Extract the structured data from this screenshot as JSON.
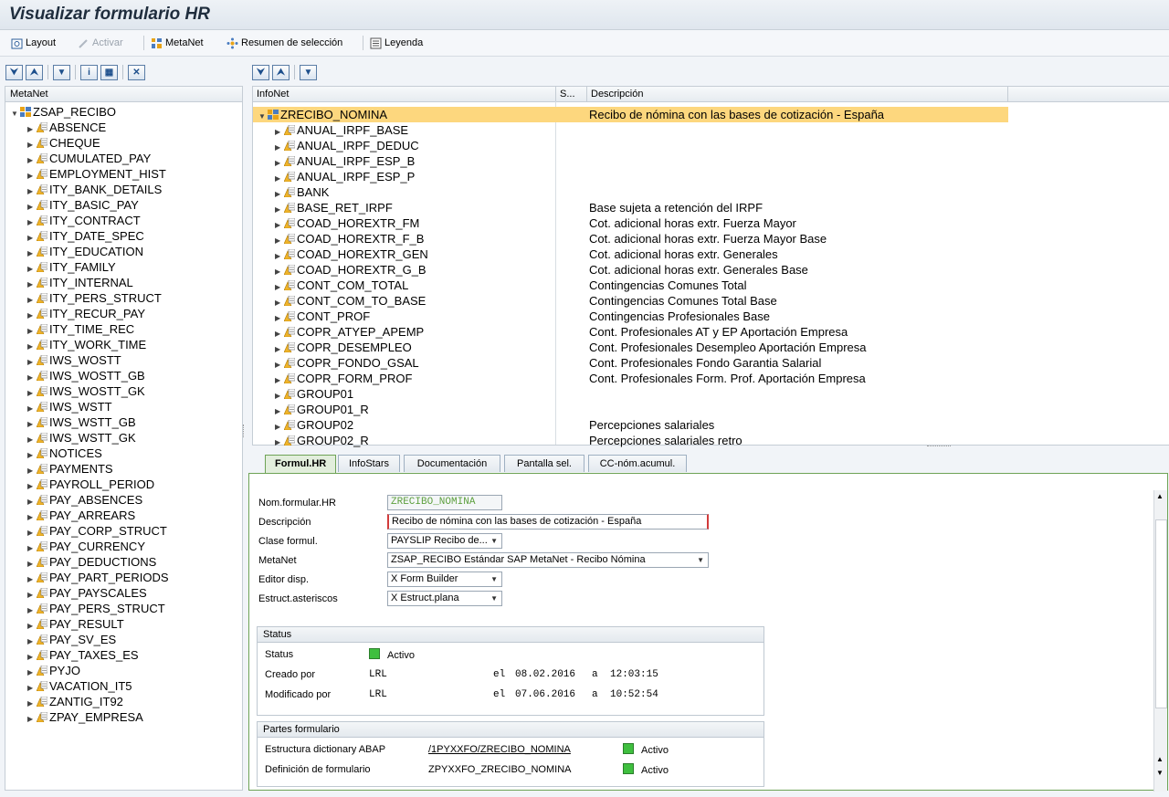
{
  "title": "Visualizar formulario HR",
  "toolbar": {
    "layout": "Layout",
    "activar": "Activar",
    "metanet": "MetaNet",
    "resumen": "Resumen de selección",
    "leyenda": "Leyenda"
  },
  "left": {
    "header": "MetaNet",
    "root": "ZSAP_RECIBO",
    "items": [
      "ABSENCE",
      "CHEQUE",
      "CUMULATED_PAY",
      "EMPLOYMENT_HIST",
      "ITY_BANK_DETAILS",
      "ITY_BASIC_PAY",
      "ITY_CONTRACT",
      "ITY_DATE_SPEC",
      "ITY_EDUCATION",
      "ITY_FAMILY",
      "ITY_INTERNAL",
      "ITY_PERS_STRUCT",
      "ITY_RECUR_PAY",
      "ITY_TIME_REC",
      "ITY_WORK_TIME",
      "IWS_WOSTT",
      "IWS_WOSTT_GB",
      "IWS_WOSTT_GK",
      "IWS_WSTT",
      "IWS_WSTT_GB",
      "IWS_WSTT_GK",
      "NOTICES",
      "PAYMENTS",
      "PAYROLL_PERIOD",
      "PAY_ABSENCES",
      "PAY_ARREARS",
      "PAY_CORP_STRUCT",
      "PAY_CURRENCY",
      "PAY_DEDUCTIONS",
      "PAY_PART_PERIODS",
      "PAY_PAYSCALES",
      "PAY_PERS_STRUCT",
      "PAY_RESULT",
      "PAY_SV_ES",
      "PAY_TAXES_ES",
      "PYJO",
      "VACATION_IT5",
      "ZANTIG_IT92",
      "ZPAY_EMPRESA"
    ]
  },
  "right": {
    "col_infonet": "InfoNet",
    "col_s": "S...",
    "col_desc": "Descripción",
    "root": {
      "name": "ZRECIBO_NOMINA",
      "desc": "Recibo de nómina con las bases de cotización - España"
    },
    "rows": [
      {
        "name": "ANUAL_IRPF_BASE",
        "desc": ""
      },
      {
        "name": "ANUAL_IRPF_DEDUC",
        "desc": ""
      },
      {
        "name": "ANUAL_IRPF_ESP_B",
        "desc": ""
      },
      {
        "name": "ANUAL_IRPF_ESP_P",
        "desc": ""
      },
      {
        "name": "BANK",
        "desc": ""
      },
      {
        "name": "BASE_RET_IRPF",
        "desc": "Base sujeta a retención del IRPF"
      },
      {
        "name": "COAD_HOREXTR_FM",
        "desc": "Cot. adicional horas extr. Fuerza Mayor"
      },
      {
        "name": "COAD_HOREXTR_F_B",
        "desc": "Cot. adicional horas extr. Fuerza Mayor Base"
      },
      {
        "name": "COAD_HOREXTR_GEN",
        "desc": "Cot. adicional horas extr. Generales"
      },
      {
        "name": "COAD_HOREXTR_G_B",
        "desc": "Cot. adicional horas extr. Generales Base"
      },
      {
        "name": "CONT_COM_TOTAL",
        "desc": "Contingencias Comunes Total"
      },
      {
        "name": "CONT_COM_TO_BASE",
        "desc": "Contingencias Comunes Total Base"
      },
      {
        "name": "CONT_PROF",
        "desc": "Contingencias Profesionales Base"
      },
      {
        "name": "COPR_ATYEP_APEMP",
        "desc": "Cont. Profesionales AT y EP Aportación Empresa"
      },
      {
        "name": "COPR_DESEMPLEO",
        "desc": "Cont. Profesionales Desempleo Aportación Empresa"
      },
      {
        "name": "COPR_FONDO_GSAL",
        "desc": "Cont. Profesionales Fondo Garantia Salarial"
      },
      {
        "name": "COPR_FORM_PROF",
        "desc": "Cont. Profesionales Form. Prof. Aportación Empresa"
      },
      {
        "name": "GROUP01",
        "desc": ""
      },
      {
        "name": "GROUP01_R",
        "desc": ""
      },
      {
        "name": "GROUP02",
        "desc": "Percepciones salariales"
      },
      {
        "name": "GROUP02_R",
        "desc": "Percepciones salariales retro"
      }
    ]
  },
  "tabs": [
    "Formul.HR",
    "InfoStars",
    "Documentación",
    "Pantalla sel.",
    "CC-nóm.acumul."
  ],
  "form": {
    "nom_label": "Nom.formular.HR",
    "nom_value": "ZRECIBO_NOMINA",
    "desc_label": "Descripción",
    "desc_value": "Recibo de nómina con las bases de cotización - España",
    "clase_label": "Clase formul.",
    "clase_value": "PAYSLIP Recibo de...",
    "metanet_label": "MetaNet",
    "metanet_value": "ZSAP_RECIBO Estándar SAP MetaNet - Recibo Nómina",
    "editor_label": "Editor disp.",
    "editor_value": "X Form Builder",
    "estruct_label": "Estruct.asteriscos",
    "estruct_value": "X Estruct.plana"
  },
  "status": {
    "header": "Status",
    "status_label": "Status",
    "status_value": "Activo",
    "creado_label": "Creado por",
    "creado_user": "LRL",
    "creado_el": "el",
    "creado_date": "08.02.2016",
    "creado_a": "a",
    "creado_time": "12:03:15",
    "mod_label": "Modificado por",
    "mod_user": "LRL",
    "mod_el": "el",
    "mod_date": "07.06.2016",
    "mod_a": "a",
    "mod_time": "10:52:54"
  },
  "partes": {
    "header": "Partes formulario",
    "r1_label": "Estructura dictionary ABAP",
    "r1_value": "/1PYXXFO/ZRECIBO_NOMINA",
    "r1_status": "Activo",
    "r2_label": "Definición de formulario",
    "r2_value": "ZPYXXFO_ZRECIBO_NOMINA",
    "r2_status": "Activo"
  }
}
